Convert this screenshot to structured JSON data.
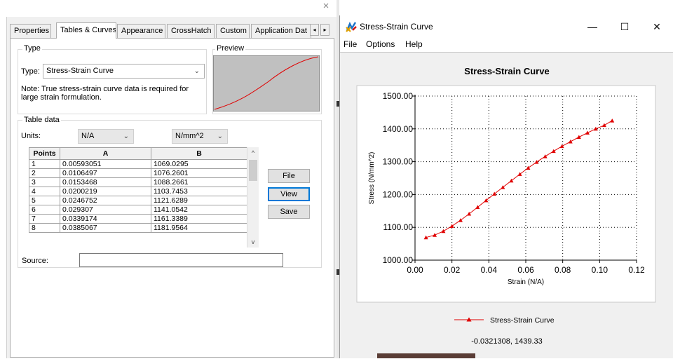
{
  "dialog": {
    "close_glyph": "×",
    "tabs": [
      {
        "label": "Properties"
      },
      {
        "label": "Tables & Curves"
      },
      {
        "label": "Appearance"
      },
      {
        "label": "CrossHatch"
      },
      {
        "label": "Custom"
      },
      {
        "label": "Application Dat"
      }
    ],
    "tab_scroll": {
      "left": "◂",
      "right": "▸"
    },
    "type_group": {
      "label": "Type",
      "type_label": "Type:",
      "type_value": "Stress-Strain Curve",
      "note": "Note: True stress-strain curve data is required for large strain formulation."
    },
    "preview": {
      "label": "Preview"
    },
    "table_group": {
      "label": "Table data",
      "units_label": "Units:",
      "unit_a": "N/A",
      "unit_b": "N/mm^2",
      "columns": [
        "Points",
        "A",
        "B"
      ],
      "rows": [
        {
          "p": "1",
          "a": "0.00593051",
          "b": "1069.0295"
        },
        {
          "p": "2",
          "a": "0.0106497",
          "b": "1076.2601"
        },
        {
          "p": "3",
          "a": "0.0153468",
          "b": "1088.2661"
        },
        {
          "p": "4",
          "a": "0.0200219",
          "b": "1103.7453"
        },
        {
          "p": "5",
          "a": "0.0246752",
          "b": "1121.6289"
        },
        {
          "p": "6",
          "a": "0.029307",
          "b": "1141.0542"
        },
        {
          "p": "7",
          "a": "0.0339174",
          "b": "1161.3389"
        },
        {
          "p": "8",
          "a": "0.0385067",
          "b": "1181.9564"
        }
      ],
      "scroll_up": "^",
      "scroll_down": "v"
    },
    "buttons": {
      "file": "File",
      "view": "View",
      "save": "Save"
    },
    "source_label": "Source:",
    "source_value": ""
  },
  "chart_window": {
    "title": "Stress-Strain Curve",
    "controls": {
      "minimize": "—",
      "maximize": "☐",
      "close": "✕"
    },
    "menu": [
      "File",
      "Options",
      "Help"
    ],
    "coordinate_readout": "-0.0321308, 1439.33"
  },
  "colors": {
    "series": "#e00000",
    "preview_bg": "#c0c0c0",
    "focus": "#0078d7"
  },
  "chart_data": {
    "type": "line",
    "title": "Stress-Strain Curve",
    "xlabel": "Strain (N/A)",
    "ylabel": "Stress (N/mm^2)",
    "xlim": [
      0,
      0.12
    ],
    "ylim": [
      1000,
      1500
    ],
    "xticks": [
      "0.00",
      "0.02",
      "0.04",
      "0.06",
      "0.08",
      "0.10",
      "0.12"
    ],
    "yticks": [
      "1000.00",
      "1100.00",
      "1200.00",
      "1300.00",
      "1400.00",
      "1500.00"
    ],
    "grid": true,
    "legend_position": "bottom",
    "series": [
      {
        "name": "Stress-Strain Curve",
        "color": "#e00000",
        "marker": "triangle",
        "x": [
          0.00593051,
          0.0106497,
          0.0153468,
          0.0200219,
          0.0246752,
          0.029307,
          0.0339174,
          0.0385067,
          0.043,
          0.0476,
          0.0522,
          0.0568,
          0.0613,
          0.0659,
          0.0705,
          0.0751,
          0.0796,
          0.0842,
          0.0888,
          0.0934,
          0.0979,
          0.1025,
          0.1068
        ],
        "y": [
          1069.0295,
          1076.2601,
          1088.2661,
          1103.7453,
          1121.6289,
          1141.0542,
          1161.3389,
          1181.9564,
          1202,
          1222,
          1242,
          1262,
          1281,
          1299,
          1316,
          1332,
          1347,
          1361,
          1375,
          1388,
          1400,
          1411,
          1425
        ]
      }
    ]
  }
}
